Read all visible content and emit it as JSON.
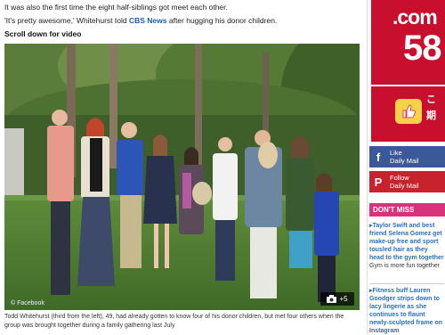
{
  "article": {
    "line1": "It was also the first time the eight half-siblings got meet each other.",
    "line2_pre": "'It's pretty awesome,' Whitehurst told ",
    "line2_link": "CBS News",
    "line2_post": " after hugging his donor children.",
    "scroll_label": "Scroll down for video",
    "photo_credit": "© Facebook",
    "gallery_count": "+5",
    "caption": "Todd Whitehurst (third from the left), 49, had already gotten to know four of his donor children, but met four others when the group was brought together during a family gathering last July"
  },
  "sidebar": {
    "ad": {
      "top_text": ".com",
      "number": "58",
      "jp1": "こ",
      "jp2": "期"
    },
    "facebook": {
      "icon": "f",
      "line1": "Like",
      "line2": "Daily Mail"
    },
    "pinterest": {
      "icon": "P",
      "line1": "Follow",
      "line2": "Daily Mail"
    },
    "section_label": "DON'T MISS",
    "stories": [
      {
        "headline": "▸Taylor Swift and best friend Selena Gomez get make-up free and sport tousled hair as they head to the gym together",
        "sub": "Gym is more fun together"
      },
      {
        "headline": "▸Fitness buff Lauren Goodger strips down to lacy lingerie as she continues to flaunt newly-sculpted frame on Instagram",
        "sub": ""
      }
    ]
  },
  "colors": {
    "link": "#1a5fa8",
    "brand_red": "#c8102e",
    "facebook": "#3b5998",
    "pinterest": "#c8232c",
    "dont_miss": "#d9317b"
  }
}
